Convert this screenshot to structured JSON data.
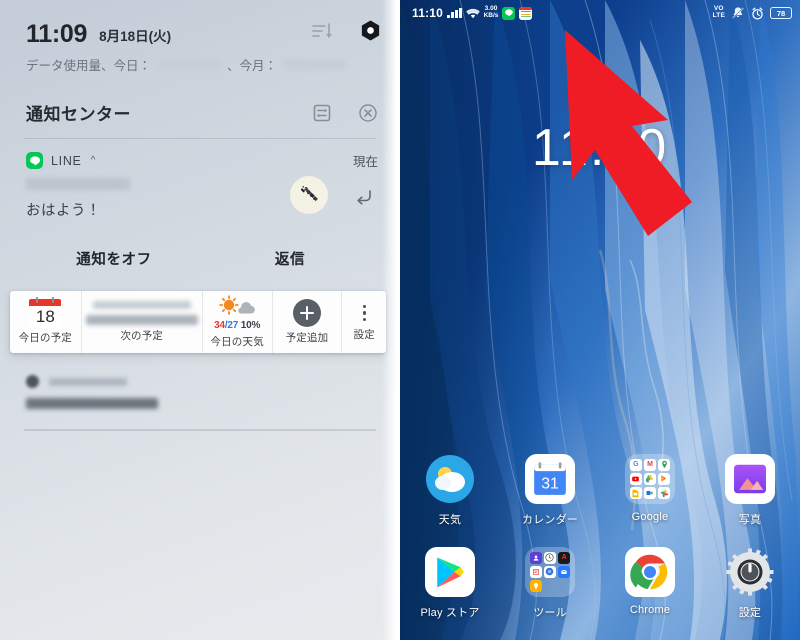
{
  "left_panel": {
    "name": "notification-shade",
    "status": {
      "clock": "11:09",
      "date": "8月18日(火)",
      "sort_icon": "sort-list-icon",
      "settings_icon": "gear-hex-icon"
    },
    "data_usage": {
      "prefix": "データ使用量、今日：",
      "middle": "、今月：",
      "today_value_redacted": true,
      "month_value_redacted": true
    },
    "notification_center": {
      "title": "通知センター",
      "manage_icon": "notification-settings-icon",
      "clear_icon": "clear-all-icon"
    },
    "notification": {
      "app_icon": "line-app-icon",
      "app_name": "LINE",
      "expand_icon": "chevron-up-icon",
      "time": "現在",
      "sender_redacted": true,
      "message": "おはよう！",
      "avatar_icon": "giraffe-avatar",
      "reply_icon": "reply-arrow-icon",
      "actions": [
        {
          "label": "通知をオフ",
          "name": "turn-off-notifications-button"
        },
        {
          "label": "返信",
          "name": "reply-button"
        }
      ]
    },
    "widget_bar": {
      "today": {
        "label": "今日の予定",
        "day_number": "18",
        "icon": "calendar-icon"
      },
      "next": {
        "label": "次の予定",
        "redacted": true
      },
      "weather": {
        "label": "今日の天気",
        "icon": "sun-cloud-icon",
        "high": "34",
        "sep": "/",
        "low": "27",
        "precip": "10%"
      },
      "add": {
        "label": "予定追加",
        "icon": "plus-icon"
      },
      "settings": {
        "label": "設定",
        "icon": "kebab-menu-icon"
      }
    },
    "lower_notification": {
      "redacted": true
    }
  },
  "right_panel": {
    "name": "home-screen",
    "status_bar": {
      "time": "11:10",
      "signal_icon": "signal-bars-icon",
      "wifi_icon": "wifi-icon",
      "network_speed_value": "3.00",
      "network_speed_unit": "KB/s",
      "app_icons": [
        "line-notification-icon",
        "calendar-notification-icon"
      ],
      "volte_line1": "VO",
      "volte_line2": "LTE",
      "mute_icon": "bell-muted-icon",
      "alarm_icon": "alarm-clock-icon",
      "battery_level": "78"
    },
    "clock_widget": {
      "time": "11:10"
    },
    "annotation": {
      "arrow_icon": "red-arrow-pointer",
      "color": "#ef1c26"
    },
    "app_rows": [
      [
        {
          "label": "天気",
          "name": "app-weather",
          "icon": "weather-app-icon"
        },
        {
          "label": "カレンダー",
          "name": "app-calendar",
          "icon": "calendar-app-icon",
          "day": "31"
        },
        {
          "label": "Google",
          "name": "folder-google",
          "icon": "google-folder-icon"
        },
        {
          "label": "写真",
          "name": "app-photos",
          "icon": "photos-app-icon"
        }
      ],
      [
        {
          "label": "Play ストア",
          "name": "app-play-store",
          "icon": "play-store-icon"
        },
        {
          "label": "ツール",
          "name": "folder-tools",
          "icon": "tools-folder-icon"
        },
        {
          "label": "Chrome",
          "name": "app-chrome",
          "icon": "chrome-icon"
        },
        {
          "label": "設定",
          "name": "app-settings",
          "icon": "settings-gear-icon"
        }
      ]
    ]
  }
}
